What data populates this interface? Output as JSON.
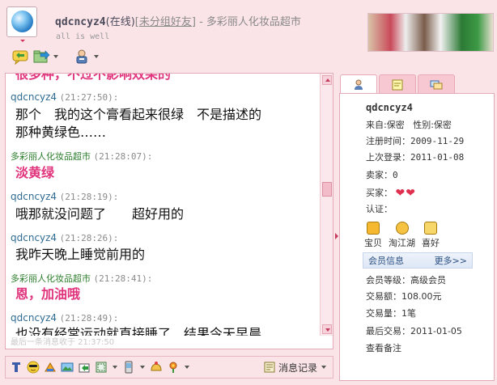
{
  "header": {
    "nickname": "qdcncyz4",
    "status": "(在线)",
    "group": "[未分组好友]",
    "shop_suffix": " - 多彩丽人化妆品超市",
    "signature": "all is well"
  },
  "toolbar": {
    "icons": [
      "chat-icon",
      "transfer-icon",
      "user-settings-icon"
    ]
  },
  "chat": {
    "top_partial": "很多种，不过不影响效果的",
    "messages": [
      {
        "sender": "qdcncyz4",
        "time": "(21:27:50):",
        "lines": [
          "那个　我的这个膏看起来很绿　不是描述的",
          "那种黄绿色……"
        ],
        "from": "me"
      },
      {
        "sender": "多彩丽人化妆品超市",
        "time": "(21:28:07):",
        "lines": [
          "淡黄绿"
        ],
        "from": "shop"
      },
      {
        "sender": "qdcncyz4",
        "time": "(21:28:19):",
        "lines": [
          "哦那就没问题了　　超好用的"
        ],
        "from": "me"
      },
      {
        "sender": "qdcncyz4",
        "time": "(21:28:26):",
        "lines": [
          "我昨天晚上睡觉前用的"
        ],
        "from": "me"
      },
      {
        "sender": "多彩丽人化妆品超市",
        "time": "(21:28:41):",
        "lines": [
          "恩，加油哦"
        ],
        "from": "shop"
      },
      {
        "sender": "qdcncyz4",
        "time": "(21:28:49):",
        "lines": [
          "也没有经常运动就直接睡了　结果今天早晨"
        ],
        "from": "me"
      }
    ],
    "status_text": "最后一条消息收于 21:37:50"
  },
  "bottom_toolbar": {
    "history_label": "消息记录"
  },
  "profile": {
    "nickname": "qdcncyz4",
    "from_label": "来自:保密",
    "gender_label": "性别:保密",
    "register_label": "注册时间：",
    "register_value": "2009-11-29",
    "last_login_label": "上次登录：",
    "last_login_value": "2011-01-08",
    "seller_label": "卖家：",
    "seller_value": "0",
    "buyer_label": "买家：",
    "auth_label": "认证：",
    "shortcuts": [
      "宝贝",
      "淘江湖",
      "喜好"
    ],
    "member_info_label": "会员信息",
    "more_label": "更多>>",
    "member_level": "会员等级：高级会员",
    "trade_amount": "交易额：108.00元",
    "trade_count": "交易量：1笔",
    "last_trade": "最后交易：2011-01-05",
    "view_note": "查看备注"
  },
  "colors": {
    "background": "#fbe4e8",
    "border": "#e3a9b6",
    "me_name": "#2e6b93",
    "shop_name": "#2c7d2c",
    "shop_text": "#e0357d"
  }
}
